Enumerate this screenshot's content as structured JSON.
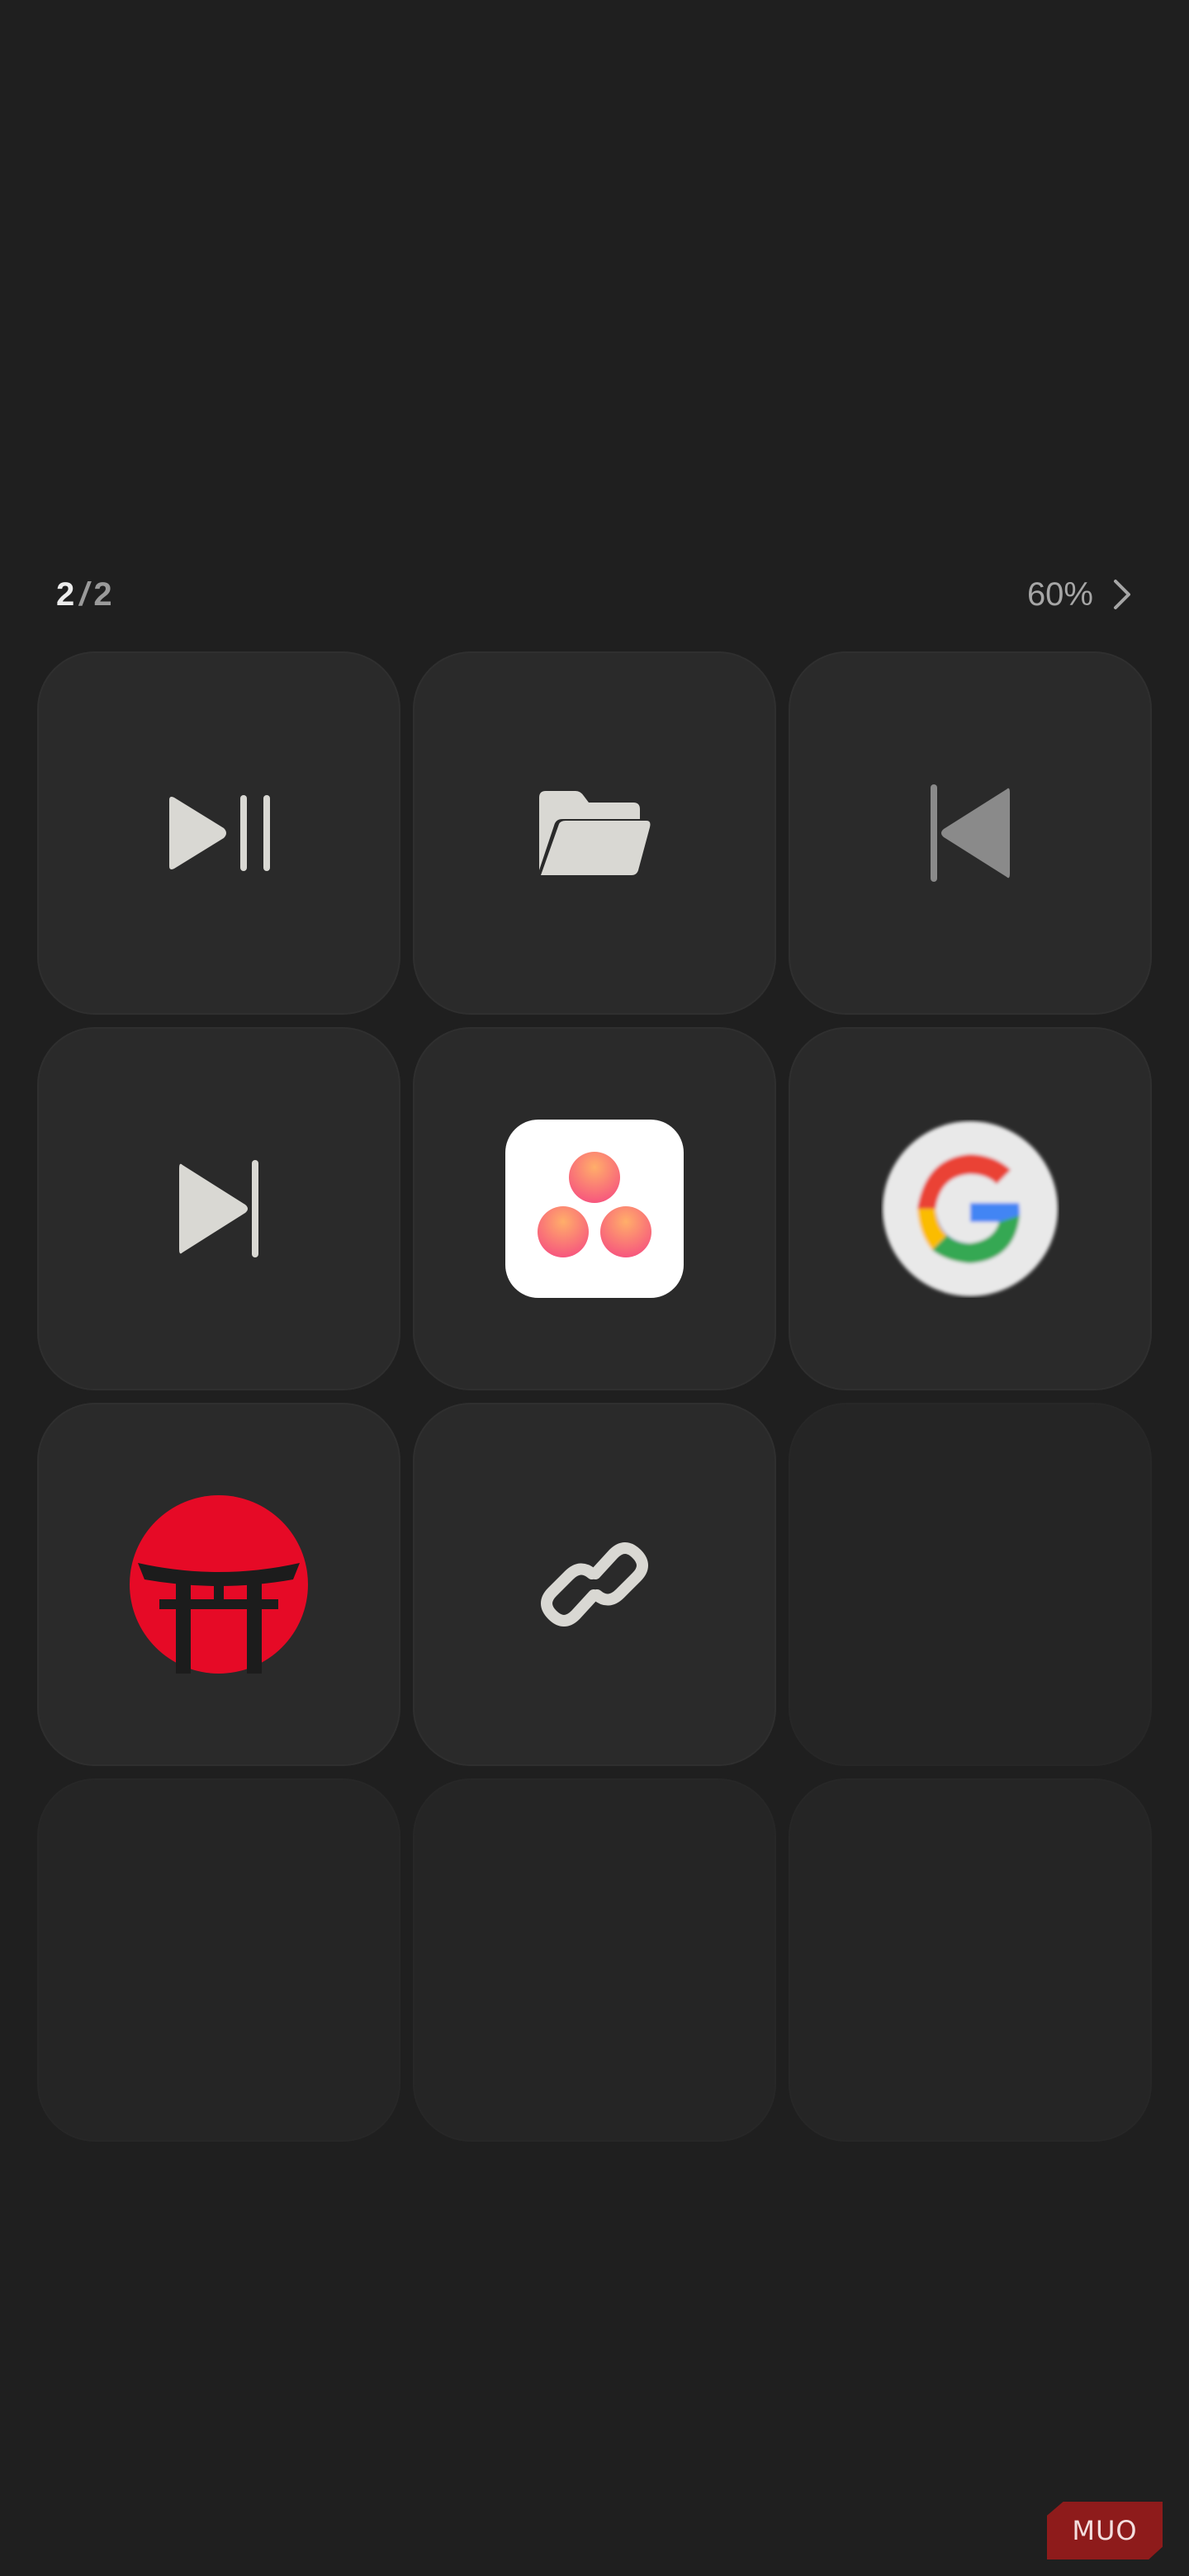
{
  "header": {
    "current_page": "2",
    "separator": "/",
    "total_pages": "2",
    "zoom": "60%"
  },
  "tiles": [
    {
      "icon": "play-pause-icon",
      "empty": false
    },
    {
      "icon": "folder-icon",
      "empty": false
    },
    {
      "icon": "skip-previous-icon",
      "empty": false,
      "state": "dimmed"
    },
    {
      "icon": "skip-next-icon",
      "empty": false
    },
    {
      "icon": "asana-logo-icon",
      "empty": false
    },
    {
      "icon": "google-logo-icon",
      "empty": false
    },
    {
      "icon": "torii-gate-icon",
      "empty": false
    },
    {
      "icon": "link-icon",
      "empty": false
    },
    {
      "icon": null,
      "empty": true
    },
    {
      "icon": null,
      "empty": true
    },
    {
      "icon": null,
      "empty": true
    },
    {
      "icon": null,
      "empty": true
    }
  ],
  "colors": {
    "background": "#1f1f1f",
    "tile": "#2a2a2a",
    "icon_light": "#d9d8d3",
    "icon_dim": "#8a8a8a",
    "torii_red": "#e60a26",
    "asana_gradient": [
      "#ff9a62",
      "#f95b7e"
    ],
    "google_blue": "#4285F4",
    "google_red": "#EA4335",
    "google_yellow": "#FBBC05",
    "google_green": "#34A853"
  },
  "watermark": {
    "text": "MUO"
  }
}
